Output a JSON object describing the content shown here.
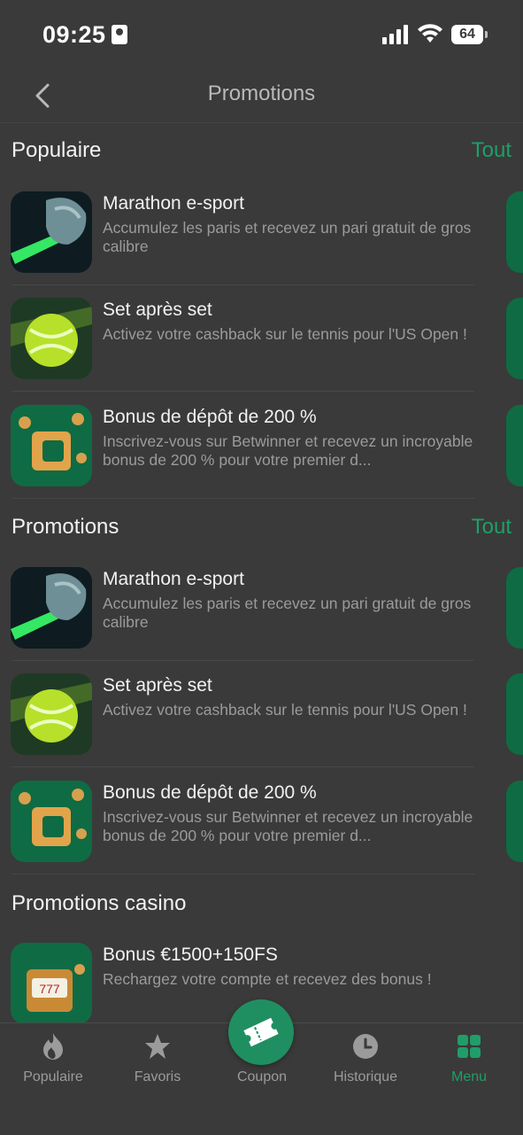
{
  "status_bar": {
    "time": "09:25",
    "battery": "64"
  },
  "header": {
    "title": "Promotions"
  },
  "sections": [
    {
      "title": "Populaire",
      "see_all": "Tout",
      "items": [
        {
          "title": "Marathon e-sport",
          "desc": "Accumulez les paris et recevez un pari gratuit de gros calibre",
          "thumb": "esport-hand-image"
        },
        {
          "title": "Set après set",
          "desc": "Activez votre cashback sur le tennis pour l'US Open !",
          "thumb": "tennis-ball-image"
        },
        {
          "title": "Bonus de dépôt de 200 %",
          "desc": "Inscrivez-vous sur Betwinner et recevez un incroyable bonus de 200 % pour votre premier d...",
          "thumb": "coins-safe-image"
        }
      ]
    },
    {
      "title": "Promotions",
      "see_all": "Tout",
      "items": [
        {
          "title": "Marathon e-sport",
          "desc": "Accumulez les paris et recevez un pari gratuit de gros calibre",
          "thumb": "esport-hand-image"
        },
        {
          "title": "Set après set",
          "desc": "Activez votre cashback sur le tennis pour l'US Open !",
          "thumb": "tennis-ball-image"
        },
        {
          "title": "Bonus de dépôt de 200 %",
          "desc": "Inscrivez-vous sur Betwinner et recevez un incroyable bonus de 200 % pour votre premier d...",
          "thumb": "coins-safe-image"
        }
      ]
    },
    {
      "title": "Promotions casino",
      "items": [
        {
          "title": "Bonus €1500+150FS",
          "desc": "Rechargez votre compte et recevez des bonus !",
          "thumb": "slot-machine-image"
        }
      ]
    }
  ],
  "nav": {
    "items": [
      {
        "label": "Populaire",
        "icon": "flame-icon"
      },
      {
        "label": "Favoris",
        "icon": "star-icon"
      },
      {
        "label": "Coupon",
        "icon": "ticket-icon"
      },
      {
        "label": "Historique",
        "icon": "clock-icon"
      },
      {
        "label": "Menu",
        "icon": "grid-icon"
      }
    ]
  },
  "colors": {
    "accent": "#1f9e69",
    "background": "#3a3a3a",
    "muted_text": "#9b9b9b"
  }
}
